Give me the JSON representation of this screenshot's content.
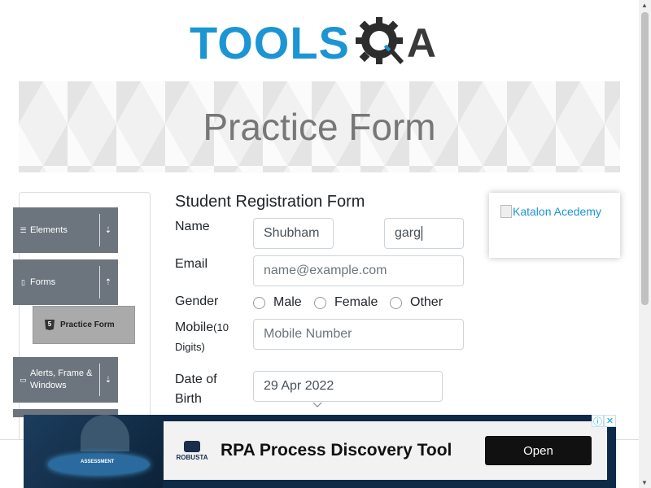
{
  "header": {
    "logo_text": "TOOLS",
    "logo_suffix": "A"
  },
  "banner": {
    "title": "Practice Form"
  },
  "sidebar": {
    "groups": [
      {
        "label": "Elements",
        "icon": "menu-icon",
        "arrow": "⇣"
      },
      {
        "label": "Forms",
        "icon": "file-icon",
        "arrow": "⇡"
      },
      {
        "label": "Alerts, Frame & Windows",
        "icon": "window-icon",
        "arrow": "⇣"
      }
    ],
    "active_item": {
      "label": "Practice Form",
      "icon": "html5-icon"
    }
  },
  "form": {
    "title": "Student Registration Form",
    "name_label": "Name",
    "first_name_value": "Shubham",
    "last_name_value": "garg",
    "email_label": "Email",
    "email_placeholder": "name@example.com",
    "gender_label": "Gender",
    "gender_options": [
      "Male",
      "Female",
      "Other"
    ],
    "mobile_label": "Mobile",
    "mobile_hint": "(10 Digits)",
    "mobile_placeholder": "Mobile Number",
    "dob_label": "Date of Birth",
    "dob_value": "29 Apr 2022"
  },
  "ad_right": {
    "alt": "Katalon Acedemy"
  },
  "ad_bottom": {
    "image_text": "ASSESSMENT",
    "brand": "ROBUSTA",
    "headline": "RPA Process Discovery Tool",
    "cta": "Open",
    "info_icon": "info-icon",
    "close_icon": "close-icon"
  },
  "colors": {
    "brand_blue": "#1b95d4",
    "sidebar_group": "#6c757d",
    "active_item": "#aaaaaa"
  }
}
